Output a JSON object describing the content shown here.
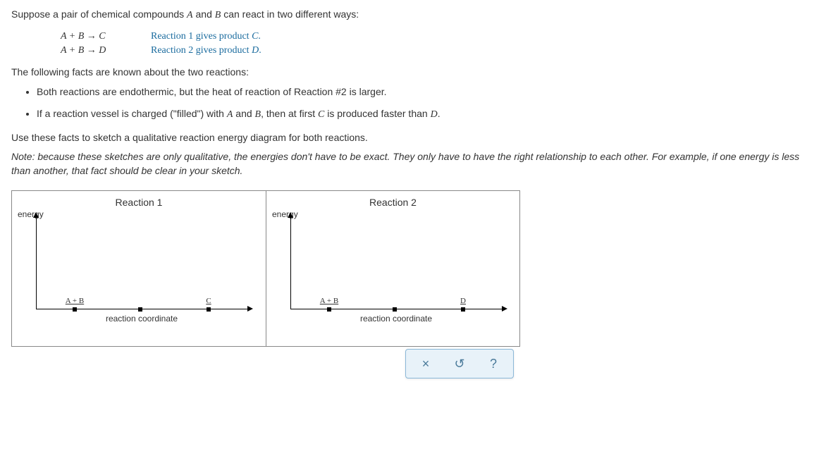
{
  "intro": "Suppose a pair of chemical compounds A and B can react in two different ways:",
  "reactions": [
    {
      "eq": "A + B → C",
      "desc": "Reaction 1 gives product C."
    },
    {
      "eq": "A + B → D",
      "desc": "Reaction 2 gives product D."
    }
  ],
  "facts_intro": "The following facts are known about the two reactions:",
  "facts": [
    "Both reactions are endothermic, but the heat of reaction of Reaction #2 is larger.",
    "If a reaction vessel is charged (\"filled\") with A and B, then at first C is produced faster than D."
  ],
  "use_line": "Use these facts to sketch a qualitative reaction energy diagram for both reactions.",
  "note_label": "Note:",
  "note_text": " because these sketches are only qualitative, the energies don't have to be exact. They only have to have the right relationship to each other. For example, if one energy is less than another, that fact should be clear in your sketch.",
  "diagram1": {
    "title": "Reaction 1",
    "energy": "energy",
    "rc": "reaction coordinate",
    "start_label": "A + B",
    "end_label": "C"
  },
  "diagram2": {
    "title": "Reaction 2",
    "energy": "energy",
    "rc": "reaction coordinate",
    "start_label": "A + B",
    "end_label": "D"
  },
  "toolbar": {
    "clear": "×",
    "reset": "↺",
    "help": "?"
  },
  "chart_data": [
    {
      "type": "scatter",
      "title": "Reaction 1",
      "xlabel": "reaction coordinate",
      "ylabel": "energy",
      "series": [
        {
          "name": "A + B",
          "x": 0,
          "y": 0
        },
        {
          "name": "transition",
          "x": 1,
          "y": 0
        },
        {
          "name": "C",
          "x": 2,
          "y": 0
        }
      ],
      "notes": "draggable points for qualitative energy diagram; initial positions on x-axis"
    },
    {
      "type": "scatter",
      "title": "Reaction 2",
      "xlabel": "reaction coordinate",
      "ylabel": "energy",
      "series": [
        {
          "name": "A + B",
          "x": 0,
          "y": 0
        },
        {
          "name": "transition",
          "x": 1,
          "y": 0
        },
        {
          "name": "D",
          "x": 2,
          "y": 0
        }
      ],
      "notes": "draggable points for qualitative energy diagram; initial positions on x-axis"
    }
  ]
}
